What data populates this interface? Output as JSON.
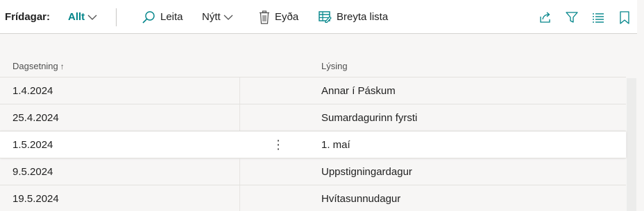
{
  "toolbar": {
    "title": "Frídagar:",
    "view_label": "Allt",
    "search_label": "Leita",
    "new_label": "Nýtt",
    "delete_label": "Eyða",
    "edit_list_label": "Breyta lista"
  },
  "icons": {
    "view": "chevron-down-icon",
    "search": "search-icon",
    "new": "chevron-down-icon",
    "delete": "trash-icon",
    "edit_list": "edit-list-icon",
    "share": "share-icon",
    "filter": "filter-icon",
    "list": "list-icon",
    "bookmark": "bookmark-icon"
  },
  "colors": {
    "accent": "#008489",
    "background": "#f7f6f5",
    "selected_row": "#ffffff"
  },
  "table": {
    "columns": [
      {
        "label": "Dagsetning",
        "sort": "↑"
      },
      {
        "label": "Lýsing"
      }
    ],
    "rows": [
      {
        "date": "1.4.2024",
        "description": "Annar í Páskum"
      },
      {
        "date": "25.4.2024",
        "description": "Sumardagurinn fyrsti"
      },
      {
        "date": "1.5.2024",
        "description": "1. maí",
        "selected": true,
        "menu": "⋮"
      },
      {
        "date": "9.5.2024",
        "description": "Uppstigningardagur"
      },
      {
        "date": "19.5.2024",
        "description": "Hvítasunnudagur"
      }
    ]
  }
}
